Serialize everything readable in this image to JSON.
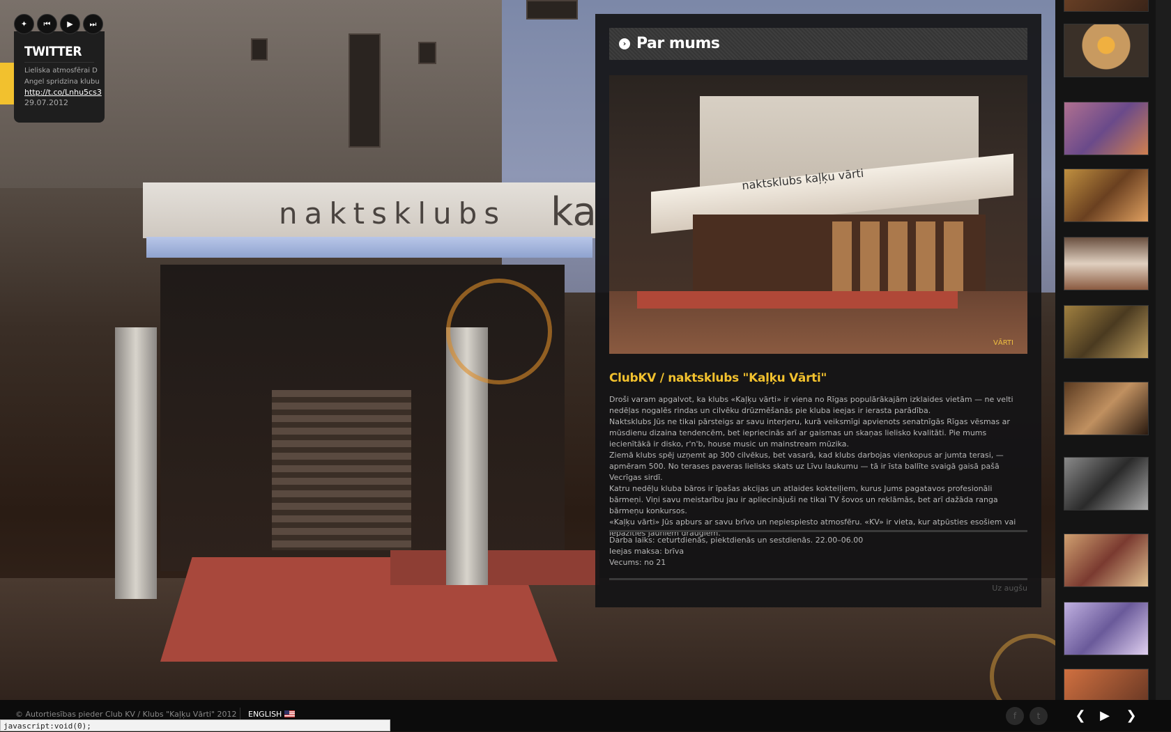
{
  "player": {
    "twitter_label": "twitter-bird",
    "prev_label": "⏮",
    "play_label": "▶",
    "next_label": "⏭"
  },
  "twitter": {
    "heading": "TWITTER",
    "tweet_line1": "Lieliska atmosfērai D",
    "tweet_line2": "Angel spridzina klubu",
    "link": "http://t.co/Lnhu5cs3",
    "date": "29.07.2012"
  },
  "panel": {
    "header_title": "Par mums",
    "photo_sign": "naktsklubs   kaļķu vārti",
    "photo_logo": "VĀRTI",
    "club_title": "ClubKV / naktsklubs \"Kaļķu Vārti\"",
    "paragraphs": [
      "Droši varam apgalvot, ka klubs «Kaļķu vārti» ir viena no Rīgas populārākajām izklaides vietām — ne velti nedēļas nogalēs rindas un cilvēku drūzmēšanās pie kluba ieejas ir ierasta parādība.",
      "Naktsklubs Jūs ne tikai pārsteigs ar savu interjeru, kurā veiksmīgi apvienots senatnīgās Rīgas vēsmas ar mūsdienu dizaina tendencēm, bet iepriecinās arī ar gaismas un skaņas lielisko kvalitāti. Pie mums iecienītākā ir disko, r'n'b, house music un mainstream mūzika.",
      "Ziemā klubs spēj uzņemt ap 300 cilvēkus, bet vasarā, kad klubs darbojas vienkopus ar jumta terasi, — apmēram 500. No terases paveras lielisks skats uz Līvu laukumu — tā ir īsta ballīte svaigā gaisā pašā Vecrīgas sirdī.",
      "Katru nedēļu kluba bāros ir īpašas akcijas un atlaides kokteiļiem, kurus Jums pagatavos profesionāli bārmeņi. Viņi savu meistarību jau ir apliecinājuši ne tikai TV šovos un reklāmās, bet arī dažāda ranga bārmeņu konkursos.",
      "«Kaļķu vārti» Jūs apburs ar savu brīvo un nepiespiesto atmosfēru. «KV» ir vieta, kur atpūsties esošiem vai iepazīties jauniem draugiem."
    ],
    "hours": "Darba laiks: ceturtdienās, piektdienās un sestdienās. 22.00–06.00",
    "entry": "Ieejas maksa: brīva",
    "age": "Vecums: no 21",
    "up_link": "Uz augšu"
  },
  "footer": {
    "copyright": "© Autortiesības pieder Club KV / Klubs \"Kaļķu Vārti\" 2012",
    "language": "ENGLISH",
    "facebook_label": "f",
    "twitter_label": "t",
    "prev_label": "❮",
    "play_label": "▶",
    "next_label": "❯"
  },
  "statusbar": "javascript:void(0);",
  "colors": {
    "accent": "#f2c12e"
  }
}
